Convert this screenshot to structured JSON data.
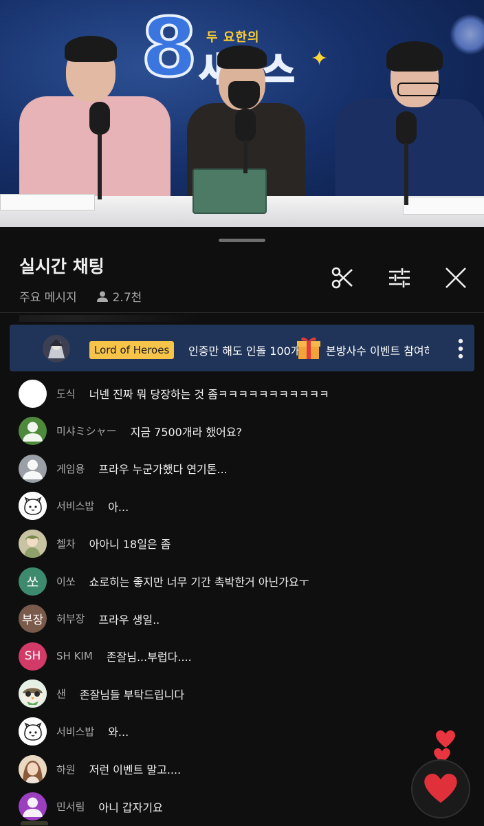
{
  "chat": {
    "title": "실시간 채팅",
    "mode_label": "주요 메시지",
    "viewer_count": "2.7천"
  },
  "video": {
    "show_number": "8",
    "show_subtitle": "두 요한의",
    "show_name": "새소스"
  },
  "pinned": {
    "badge": "Lord of Heroes",
    "text_part1": "인증만 해도 인돌 100개",
    "text_part2": "본방사수 이벤트 참여하"
  },
  "messages": [
    {
      "author": "도식",
      "text": "너넨 진짜 뭐 당장하는 것 좀ㅋㅋㅋㅋㅋㅋㅋㅋㅋㅋㅋ",
      "avatar_type": "white",
      "avatar_color": "#ffffff"
    },
    {
      "author": "미샤ミシャー",
      "text": "지금 7500개라 했어요?",
      "avatar_type": "person-green",
      "avatar_color": "#4f8a3c"
    },
    {
      "author": "게임용",
      "text": "프라우 누군가했다 연기톤...",
      "avatar_type": "person-gray",
      "avatar_color": "#9aa0a6"
    },
    {
      "author": "서비스밥",
      "text": "아...",
      "avatar_type": "drawing",
      "avatar_color": "#ffffff"
    },
    {
      "author": "첼차",
      "text": "아아니 18일은 좀",
      "avatar_type": "anime",
      "avatar_color": "#b9b08a"
    },
    {
      "author": "이쏘",
      "avatar_text": "쏘",
      "text": "쇼로히는 좋지만 너무 기간 촉박한거 아닌가요ㅜ",
      "avatar_type": "letter",
      "avatar_color": "#3d8a6e"
    },
    {
      "author": "허부장",
      "avatar_text": "부장",
      "text": "프라우 생일..",
      "avatar_type": "letter",
      "avatar_color": "#7a5a4a"
    },
    {
      "author": "SH KIM",
      "avatar_text": "SH",
      "text": "존잘님...부럽다....",
      "avatar_type": "letter",
      "avatar_color": "#d23a68"
    },
    {
      "author": "샌",
      "text": "존잘님들 부탁드립니다",
      "avatar_type": "owl",
      "avatar_color": "#dfe8e0"
    },
    {
      "author": "서비스밥",
      "text": "와...",
      "avatar_type": "drawing",
      "avatar_color": "#ffffff"
    },
    {
      "author": "하원",
      "text": "저런 이벤트 말고....",
      "avatar_type": "photo",
      "avatar_color": "#e9c9a8"
    },
    {
      "author": "민서림",
      "text": "아니 갑자기요",
      "avatar_type": "person-purple",
      "avatar_color": "#9b3fc0"
    }
  ],
  "icons": {
    "clip": "scissors-icon",
    "filter": "sliders-icon",
    "close": "close-icon",
    "viewers": "person-icon",
    "more": "more-vert-icon",
    "gift": "gift-icon",
    "reaction": "heart-icon"
  },
  "colors": {
    "background": "#0f0f0f",
    "banner": "#203459",
    "badge": "#f7c44a",
    "heart": "#e0303a"
  }
}
